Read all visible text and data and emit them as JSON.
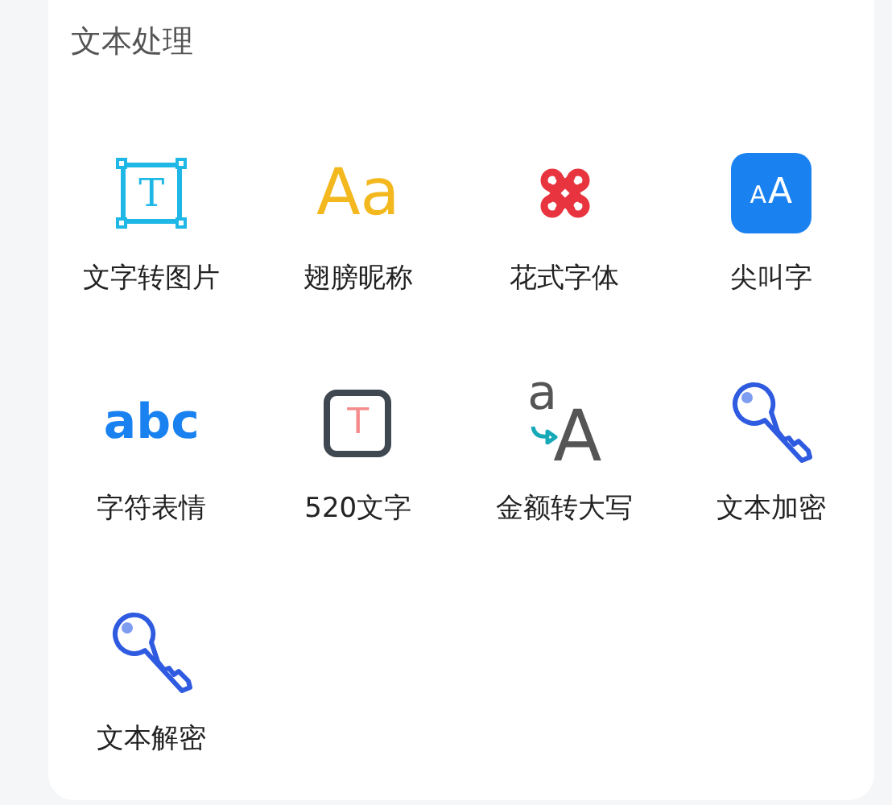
{
  "section": {
    "title": "文本处理",
    "tools": [
      {
        "label": "文字转图片",
        "icon": {
          "kind": "frame",
          "glyphs": [
            "T"
          ]
        }
      },
      {
        "label": "翅膀昵称",
        "icon": {
          "kind": "letters-gold",
          "glyphs": [
            "Aa"
          ]
        }
      },
      {
        "label": "花式字体",
        "icon": {
          "kind": "knot"
        }
      },
      {
        "label": "尖叫字",
        "icon": {
          "kind": "tile",
          "glyphs": [
            "A",
            "A"
          ]
        }
      },
      {
        "label": "字符表情",
        "icon": {
          "kind": "letters-blue",
          "glyphs": [
            "abc"
          ]
        }
      },
      {
        "label": "520文字",
        "icon": {
          "kind": "square",
          "glyphs": [
            "T"
          ]
        }
      },
      {
        "label": "金额转大写",
        "icon": {
          "kind": "convert",
          "glyphs": [
            "a",
            "A"
          ]
        }
      },
      {
        "label": "文本加密",
        "icon": {
          "kind": "key"
        }
      },
      {
        "label": "文本解密",
        "icon": {
          "kind": "key"
        }
      }
    ]
  }
}
